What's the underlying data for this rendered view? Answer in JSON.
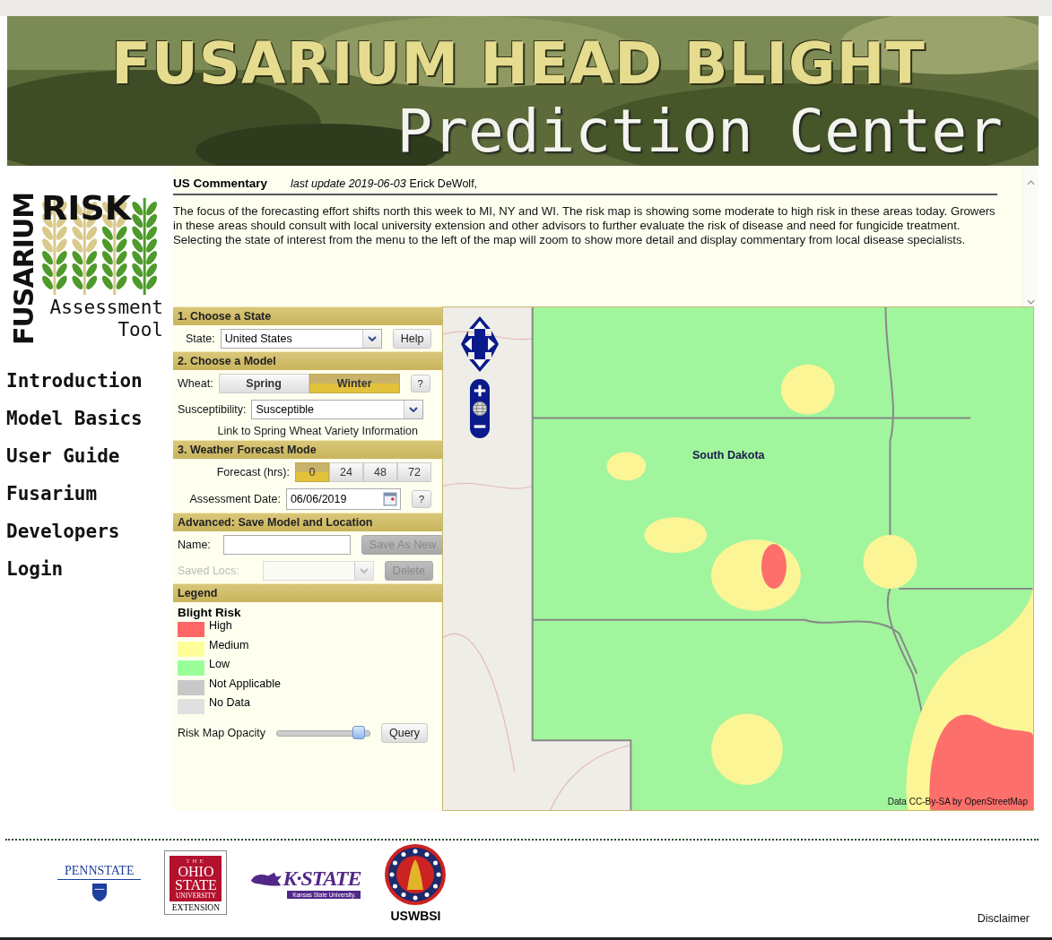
{
  "banner": {
    "title": "FUSARIUM HEAD BLIGHT",
    "subtitle": "Prediction Center"
  },
  "logo": {
    "vertical": "FUSARIUM",
    "word": "RISK",
    "line1": "Assessment",
    "line2": "Tool"
  },
  "nav": [
    {
      "label": "Introduction"
    },
    {
      "label": "Model Basics"
    },
    {
      "label": "User Guide"
    },
    {
      "label": "Fusarium"
    },
    {
      "label": "Developers"
    },
    {
      "label": "Login"
    }
  ],
  "commentary": {
    "title": "US Commentary",
    "update": "last update 2019-06-03",
    "author": "Erick DeWolf,",
    "body": "The focus of the forecasting effort shifts north this week to MI, NY and WI. The risk map is showing some moderate to high risk in these areas today. Growers in these areas should consult with local university extension and other advisors to further evaluate the risk of disease and need for fungicide treatment. Selecting the state of interest from the menu to the left of the map will zoom to show more detail and display commentary from local disease specialists."
  },
  "state_section": {
    "heading": "1. Choose a State",
    "label": "State:",
    "value": "United States",
    "help": "Help"
  },
  "model_section": {
    "heading": "2. Choose a Model",
    "wheat_label": "Wheat:",
    "wheat_options": [
      {
        "label": "Spring",
        "selected": false
      },
      {
        "label": "Winter",
        "selected": true
      }
    ],
    "help": "?",
    "susceptibility_label": "Susceptibility:",
    "susceptibility": "Susceptible",
    "link": "Link to Spring Wheat Variety Information"
  },
  "forecast_section": {
    "heading": "3. Weather Forecast Mode",
    "forecast_label": "Forecast (hrs):",
    "hours": [
      {
        "label": "0",
        "selected": true
      },
      {
        "label": "24",
        "selected": false
      },
      {
        "label": "48",
        "selected": false
      },
      {
        "label": "72",
        "selected": false
      }
    ],
    "date_label": "Assessment Date:",
    "date": "06/06/2019",
    "help": "?"
  },
  "save_section": {
    "heading": "Advanced: Save Model and Location",
    "name_label": "Name:",
    "save_button": {
      "label": "Save As New",
      "disabled": true
    },
    "saved_label": "Saved Locs:",
    "saved_disabled": true,
    "delete_button": {
      "label": "Delete",
      "disabled": true
    }
  },
  "legend": {
    "heading": "Legend",
    "title": "Blight Risk",
    "items": [
      {
        "label": "High",
        "color": "#ff6666"
      },
      {
        "label": "Medium",
        "color": "#ffff99"
      },
      {
        "label": "Low",
        "color": "#99ff99"
      },
      {
        "label": "Not Applicable",
        "color": "#c8c8c8"
      },
      {
        "label": "No Data",
        "color": "#e0e0e0"
      }
    ],
    "opacity_label": "Risk Map Opacity",
    "opacity": {
      "level": 0.88
    },
    "query": "Query"
  },
  "map": {
    "kind": "picture",
    "region_label": "South Dakota",
    "attribution": "Data CC-By-SA by OpenStreetMap"
  },
  "footer": {
    "pennstate": "PENNSTATE",
    "ohio": [
      "THE",
      "OHIO",
      "STATE",
      "UNIVERSITY",
      "EXTENSION"
    ],
    "kstate": "K·STATE",
    "kstate_sub": "Kansas State University.",
    "uswbsi": "USWBSI",
    "disclaimer": "Disclaimer"
  }
}
